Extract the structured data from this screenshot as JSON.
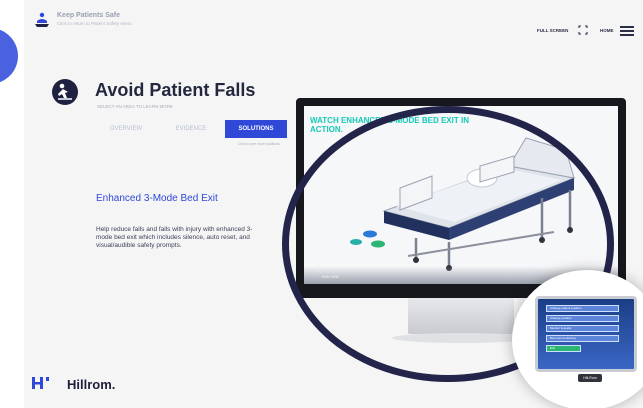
{
  "header": {
    "title": "Keep Patients Safe",
    "subtitle": "Click to return to Patient Safety menu",
    "fullscreen_label": "FULL SCREEN",
    "home_label": "HOME"
  },
  "page": {
    "title": "Avoid Patient Falls",
    "instruction": "SELECT AN AREA TO LEARN MORE",
    "see_more": "Click to see more solutions"
  },
  "tabs": [
    {
      "label": "OVERVIEW",
      "active": false
    },
    {
      "label": "EVIDENCE",
      "active": false
    },
    {
      "label": "SOLUTIONS",
      "active": true
    }
  ],
  "feature": {
    "title": "Enhanced 3-Mode Bed Exit",
    "description": "Help reduce falls and falls with injury with enhanced 3-mode bed exit which includes silence, auto reset, and visual/audible safety prompts."
  },
  "video": {
    "headline": "WATCH ENHANCED 3-MODE BED EXIT IN ACTION.",
    "control_text": "0:00 / 0:00"
  },
  "pendant": {
    "rows": [
      "Change patient position",
      "Change position",
      "Monitor & assist",
      "Bed exit monitoring",
      "Exit"
    ],
    "button": "Hill-Rom"
  },
  "footer": {
    "brand": "Hillrom."
  },
  "colors": {
    "accent_blue": "#2f48d8",
    "teal": "#16c9b7",
    "navy": "#1f2140",
    "ring": "#23244a"
  },
  "icons": [
    "patient-safety-icon",
    "fullscreen-icon",
    "menu-icon",
    "patient-fall-icon",
    "play-icon",
    "hospital-bed-image",
    "hillrom-logo-icon"
  ]
}
